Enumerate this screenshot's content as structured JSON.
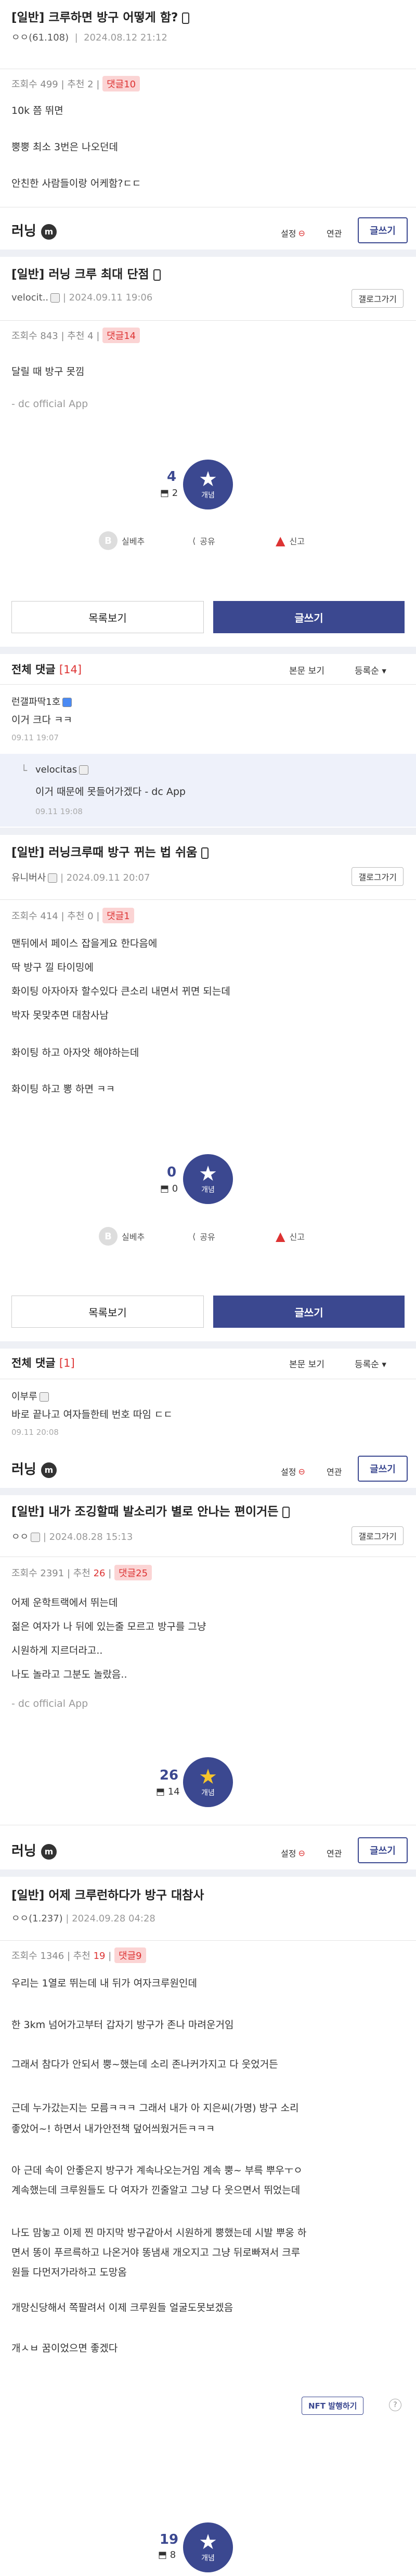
{
  "post1": {
    "title": "[일반] 크루하면 방구 어떻게 함?",
    "author": "ㅇㅇ(61.108)",
    "date": "2024.08.12 21:12",
    "views": "조회수 499",
    "recommend_label": "추천",
    "recommend": "2",
    "replies": "댓글10",
    "body": [
      "10k 쯤 뛰면",
      "뿡뿡 최소 3번은 나오던데",
      "안친한 사람들이랑 어케함?ㄷㄷ"
    ]
  },
  "bar": {
    "gallery": "러닝",
    "setting": "설정",
    "related": "연관",
    "write": "글쓰기"
  },
  "post2": {
    "title": "[일반] 러닝 크루 최대 단점",
    "author": "velocit..",
    "date": "2024.09.11 19:06",
    "gallog": "갤로그가기",
    "views": "조회수 843",
    "recommend_label": "추천",
    "recommend": "4",
    "replies": "댓글14",
    "body": [
      "달릴 때 방구 못낌"
    ],
    "source": "- dc official App",
    "up": "4",
    "fixed": "2",
    "star_label": "개념",
    "share_mydcc": "실베추",
    "share": "공유",
    "report": "신고"
  },
  "buttons": {
    "list": "목록보기",
    "write": "글쓰기"
  },
  "comments1": {
    "title": "전체 댓글",
    "count": "[14]",
    "view_body": "본문 보기",
    "order": "등록순",
    "items": [
      {
        "name": "런갤파딱1호",
        "body": "이거 크다 ㅋㅋ",
        "date": "09.11 19:07"
      }
    ],
    "reply": {
      "name": "velocitas",
      "body": "이거 때문에 못들어가겠다 - dc App",
      "date": "09.11 19:08"
    }
  },
  "post3": {
    "title": "[일반] 러닝크루때 방구 뀌는 법 쉬움",
    "author": "유니버사",
    "date": "2024.09.11 20:07",
    "gallog": "갤로그가기",
    "views": "조회수 414",
    "recommend_label": "추천",
    "recommend": "0",
    "replies": "댓글1",
    "body": [
      "맨뒤에서 페이스 잡을게요 한다음에",
      "딱 방구 낄 타이밍에",
      "화이팅 아자아자 할수있다 큰소리 내면서 뀌면 되는데",
      "박자 못맞추면 대참사남",
      "화이팅 하고 아자앗 해야하는데",
      "화이팅 하고 뽕 하면 ㅋㅋ"
    ],
    "up": "0",
    "fixed": "0",
    "star_label": "개념",
    "share_mydcc": "실베추",
    "share": "공유",
    "report": "신고"
  },
  "comments2": {
    "title": "전체 댓글",
    "count": "[1]",
    "view_body": "본문 보기",
    "order": "등록순",
    "items": [
      {
        "name": "이부루",
        "body": "바로 끝나고 여자들한테 번호 따임 ㄷㄷ",
        "date": "09.11 20:08"
      }
    ]
  },
  "post4": {
    "title": "[일반] 내가 조깅할때 발소리가 별로 안나는 편이거든",
    "author": "ㅇㅇ",
    "date": "2024.08.28 15:13",
    "gallog": "갤로그가기",
    "views": "조회수 2391",
    "recommend_label": "추천",
    "recommend": "26",
    "replies": "댓글25",
    "body": [
      "어제 운학트랙에서 뛰는데",
      "젊은 여자가 나 뒤에 있는줄 모르고 방구를 그냥",
      "시원하게 지르더라고..",
      "나도 놀라고 그분도 놀랐음.."
    ],
    "source": "- dc official App",
    "up": "26",
    "fixed": "14",
    "star_label": "개념"
  },
  "post5": {
    "title": "[일반] 어제 크루런하다가 방구 대참사",
    "author": "ㅇㅇ(1.237)",
    "date": "2024.09.28 04:28",
    "views": "조회수 1346",
    "recommend_label": "추천",
    "recommend": "19",
    "replies": "댓글9",
    "body": [
      "우리는 1열로 뛰는데 내 뒤가 여자크루원인데",
      "한 3km 넘어가고부터 갑자기 방구가 존나 마려운거임",
      "그래서 참다가 안되서 뿡~했는데 소리 존나커가지고 다 웃었거든",
      "근데 누가갔는지는 모름ㅋㅋㅋ 그래서 내가 아 지은씨(가명) 방구 소리",
      "좋았어~! 하면서 내가안전책 덮어씌웠거든ㅋㅋㅋ",
      "아 근데 속이 안좋은지 방구가 계속나오는거임 계속 뿡~ 부륵 뿌우ㅜㅇ",
      "계속했는데 크루원들도 다 여자가 낀줄알고 그냥 다 웃으면서 뛰었는데",
      "나도 맘놓고 이제 찐 마지막 방구같아서 시원하게 뿡했는데 시발 뿌웅 하",
      "면서 똥이 푸르륵하고 나온거야 똥냄새 개오지고 그냥 뒤로빠져서 크루",
      "원들 다먼저가라하고 도망옴",
      "개망신당해서 쪽팔려서 이제 크루원들 얼굴도못보겠음",
      "개ㅅㅂ 꿈이었으면 좋겠다"
    ],
    "nft": "NFT 발행하기",
    "up": "19",
    "fixed": "8",
    "star_label": "개념"
  },
  "icons": {
    "star": "star-icon",
    "fixed": "fixed-icon",
    "share": "share-icon",
    "report": "siren-icon"
  }
}
